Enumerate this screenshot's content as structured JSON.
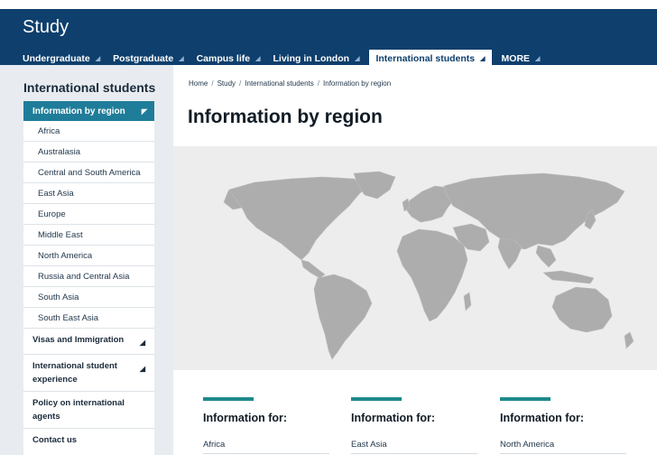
{
  "header": {
    "title": "Study",
    "nav": [
      {
        "label": "Undergraduate",
        "active": false
      },
      {
        "label": "Postgraduate",
        "active": false
      },
      {
        "label": "Campus life",
        "active": false
      },
      {
        "label": "Living in London",
        "active": false
      },
      {
        "label": "International students",
        "active": true
      },
      {
        "label": "MORE",
        "active": false
      }
    ],
    "nav_icon": "triangle-down-right-icon"
  },
  "sidebar": {
    "title": "International students",
    "active_item": "Information by region",
    "sub_items": [
      "Africa",
      "Australasia",
      "Central and South America",
      "East Asia",
      "Europe",
      "Middle East",
      "North America",
      "Russia and Central Asia",
      "South Asia",
      "South East Asia"
    ],
    "sections": [
      {
        "label": "Visas and Immigration",
        "expandable": true
      },
      {
        "label": "International student experience",
        "expandable": true
      },
      {
        "label": "Policy on international agents",
        "expandable": false
      },
      {
        "label": "Contact us",
        "expandable": false
      }
    ]
  },
  "breadcrumb": [
    "Home",
    "Study",
    "International students",
    "Information by region"
  ],
  "page": {
    "title": "Information by region"
  },
  "map": {
    "land_color": "#adadad",
    "background_color": "#ededed"
  },
  "info": [
    {
      "heading": "Information for:",
      "item": "Africa"
    },
    {
      "heading": "Information for:",
      "item": "East Asia"
    },
    {
      "heading": "Information for:",
      "item": "North America"
    }
  ],
  "colors": {
    "header": "#0e3f6d",
    "accent": "#1f7d99",
    "info_bar": "#1f8a8a"
  }
}
